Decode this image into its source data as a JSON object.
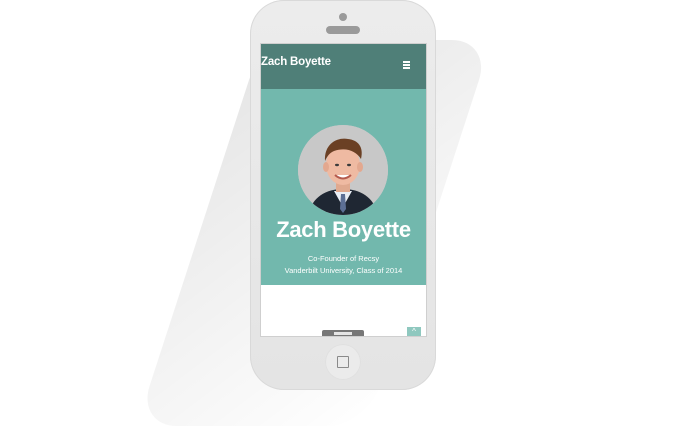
{
  "navbar": {
    "brand": "Zach Boyette",
    "menu_icon": "hamburger-icon"
  },
  "hero": {
    "name": "Zach Boyette",
    "line1": "Co-Founder of Recsy",
    "line2": "Vanderbilt University, Class of 2014"
  },
  "colors": {
    "navbar": "#4f7f78",
    "hero": "#72b8ad",
    "phone_body": "#e8e8e8"
  },
  "icons": {
    "back_to_top": "chevron-up-icon",
    "home": "home-button-icon"
  },
  "back_to_top_symbol": "^"
}
